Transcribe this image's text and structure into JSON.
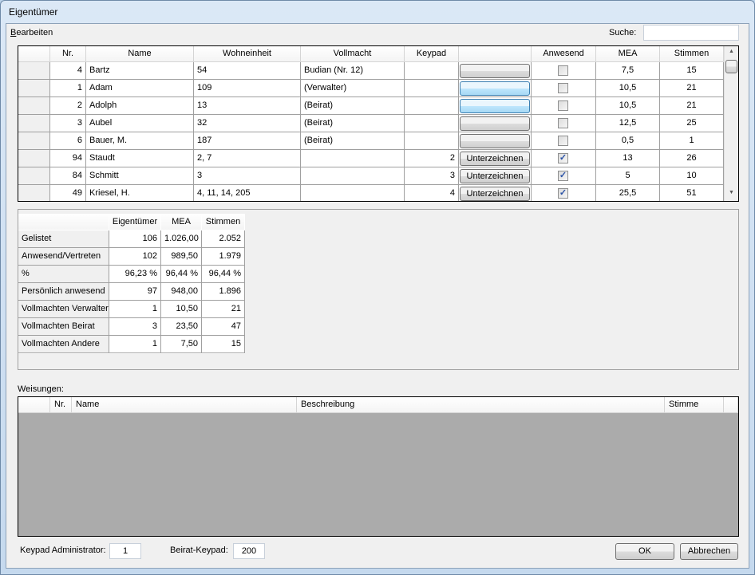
{
  "window": {
    "title": "Eigentümer"
  },
  "menu": {
    "edit_prefix": "B",
    "edit_rest": "earbeiten"
  },
  "search": {
    "label": "Suche:",
    "value": ""
  },
  "owners": {
    "columns": [
      "Nr.",
      "Name",
      "Wohneinheit",
      "Vollmacht",
      "Keypad",
      "",
      "Anwesend",
      "MEA",
      "Stimmen"
    ],
    "sort_icon": "sort-descending-icon",
    "rows": [
      {
        "nr": "4",
        "name": "Bartz",
        "wohneinheit": "54",
        "vollmacht": "Budian (Nr. 12)",
        "keypad": "",
        "button": "",
        "button_state": "normal",
        "anwesend": false,
        "mea": "7,5",
        "stimmen": "15"
      },
      {
        "nr": "1",
        "name": "Adam",
        "wohneinheit": "109",
        "vollmacht": "(Verwalter)",
        "keypad": "",
        "button": "",
        "button_state": "hot",
        "anwesend": false,
        "mea": "10,5",
        "stimmen": "21"
      },
      {
        "nr": "2",
        "name": "Adolph",
        "wohneinheit": "13",
        "vollmacht": "(Beirat)",
        "keypad": "",
        "button": "",
        "button_state": "hot",
        "anwesend": false,
        "mea": "10,5",
        "stimmen": "21"
      },
      {
        "nr": "3",
        "name": "Aubel",
        "wohneinheit": "32",
        "vollmacht": "(Beirat)",
        "keypad": "",
        "button": "",
        "button_state": "normal",
        "anwesend": false,
        "mea": "12,5",
        "stimmen": "25"
      },
      {
        "nr": "6",
        "name": "Bauer, M.",
        "wohneinheit": "187",
        "vollmacht": "(Beirat)",
        "keypad": "",
        "button": "",
        "button_state": "normal",
        "anwesend": false,
        "mea": "0,5",
        "stimmen": "1"
      },
      {
        "nr": "94",
        "name": "Staudt",
        "wohneinheit": "2, 7",
        "vollmacht": "",
        "keypad": "2",
        "button": "Unterzeichnen",
        "button_state": "normal",
        "anwesend": true,
        "mea": "13",
        "stimmen": "26"
      },
      {
        "nr": "84",
        "name": "Schmitt",
        "wohneinheit": "3",
        "vollmacht": "",
        "keypad": "3",
        "button": "Unterzeichnen",
        "button_state": "normal",
        "anwesend": true,
        "mea": "5",
        "stimmen": "10"
      },
      {
        "nr": "49",
        "name": "Kriesel, H.",
        "wohneinheit": "4, 11, 14, 205",
        "vollmacht": "",
        "keypad": "4",
        "button": "Unterzeichnen",
        "button_state": "normal",
        "anwesend": true,
        "mea": "25,5",
        "stimmen": "51"
      }
    ]
  },
  "summary": {
    "columns": [
      "",
      "Eigentümer",
      "MEA",
      "Stimmen"
    ],
    "rows": [
      [
        "Gelistet",
        "106",
        "1.026,00",
        "2.052"
      ],
      [
        "Anwesend/Vertreten",
        "102",
        "989,50",
        "1.979"
      ],
      [
        "%",
        "96,23 %",
        "96,44 %",
        "96,44 %"
      ],
      [
        "Persönlich anwesend",
        "97",
        "948,00",
        "1.896"
      ],
      [
        "Vollmachten Verwalter",
        "1",
        "10,50",
        "21"
      ],
      [
        "Vollmachten Beirat",
        "3",
        "23,50",
        "47"
      ],
      [
        "Vollmachten Andere",
        "1",
        "7,50",
        "15"
      ]
    ]
  },
  "weisungen": {
    "label": "Weisungen:",
    "columns": [
      "Nr.",
      "Name",
      "Beschreibung",
      "Stimme"
    ],
    "rows": []
  },
  "footer": {
    "keypad_admin_label": "Keypad Administrator:",
    "keypad_admin_value": "1",
    "beirat_label": "Beirat-Keypad:",
    "beirat_value": "200",
    "ok": "OK",
    "cancel": "Abbrechen"
  }
}
